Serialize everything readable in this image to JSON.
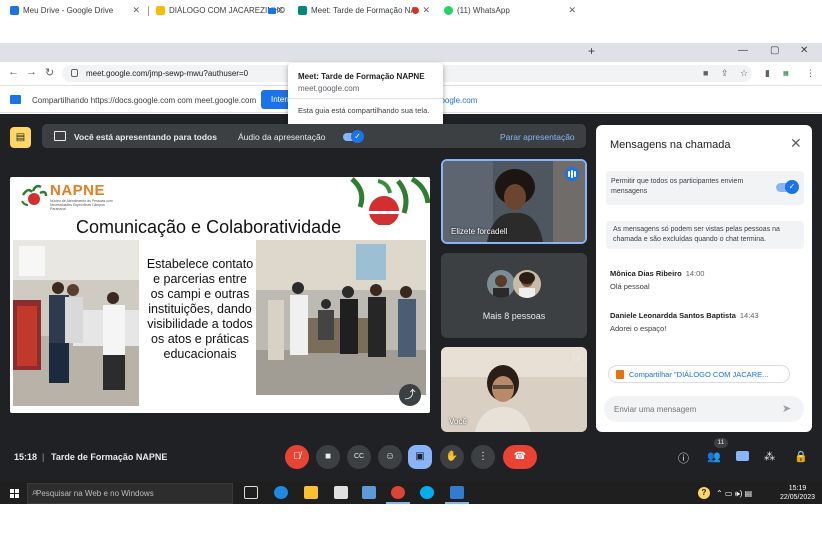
{
  "browser": {
    "tabs": [
      {
        "label": "Meu Drive - Google Drive",
        "color": "#1a73e8"
      },
      {
        "label": "DIÁLOGO COM JACAREZINHO",
        "color": "#fbbc04"
      },
      {
        "label": "Meet: Tarde de Formação NA",
        "color": "#00897b"
      },
      {
        "label": "(11) WhatsApp",
        "color": "#25d366"
      }
    ],
    "new_tab": "+",
    "url": "meet.google.com/jmp-sewp-mwu?authuser=0",
    "win_min": "—",
    "win_max": "▢",
    "win_close": "✕"
  },
  "sharebar": {
    "text": "Compartilhando https://docs.google.com com meet.google.com",
    "button": "Interromper",
    "link": "google.com"
  },
  "popup": {
    "title": "Meet: Tarde de Formação NAPNE",
    "url": "meet.google.com",
    "message": "Esta guia está compartilhando sua tela."
  },
  "presenting": {
    "label": "Você está apresentando para todos",
    "audio_label": "Áudio da apresentação",
    "stop": "Parar apresentação"
  },
  "slide": {
    "logo": "NAPNE",
    "logo_sub": "Núcleo de Atendimento às Pessoas com Necessidades Específicas Câmpus Paranavaí",
    "title": "Comunicação e Colaboratividade",
    "body": "Estabelece contato e parcerias entre os campi e outras instituições, dando visibilidade a todos os atos e práticas educacionais"
  },
  "tiles": {
    "elizete": "Elizete forcadell",
    "more": "Mais 8 pessoas",
    "voce": "Você"
  },
  "chat": {
    "title": "Mensagens na chamada",
    "permission": "Permitir que todos os participantes enviem mensagens",
    "note": "As mensagens só podem ser vistas pelas pessoas na chamada e são excluídas quando o chat termina.",
    "messages": [
      {
        "author": "Mônica Dias Ribeiro",
        "time": "14:00",
        "body": "Olá pessoal"
      },
      {
        "author": "Daniele Leonardda Santos Baptista",
        "time": "14:43",
        "body": "Adorei o espaço!"
      }
    ],
    "pinned": "Compartilhar \"DIÁLOGO COM JACARE...",
    "input_placeholder": "Enviar uma mensagem"
  },
  "controls": {
    "time": "15:18",
    "separator": "|",
    "meeting": "Tarde de Formação NAPNE",
    "people_count": "11"
  },
  "taskbar": {
    "search": "Pesquisar na Web e no Windows",
    "tray": "⌃ ▭ 🕪) ▤",
    "time": "15:19",
    "date": "22/05/2023"
  },
  "colors": {
    "accent": "#1a73e8",
    "danger": "#ea4335",
    "meet_bg": "#202124"
  }
}
